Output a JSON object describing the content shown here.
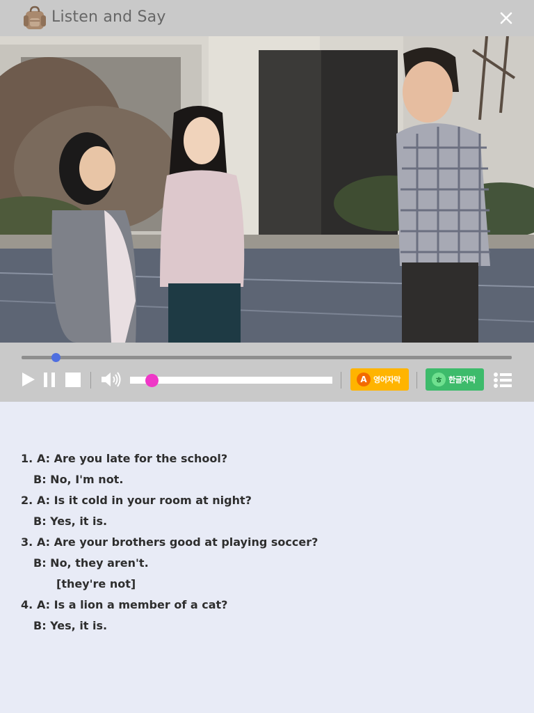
{
  "header": {
    "title": "Listen and Say",
    "close_icon": "close-icon",
    "logo_icon": "backpack-icon"
  },
  "video": {
    "scene": "video-frame"
  },
  "player": {
    "progress": 0.07,
    "volume": 0.11,
    "english_subtitle_badge": "A",
    "english_subtitle_label": "영어자막",
    "korean_subtitle_badge": "ㅎ",
    "korean_subtitle_label": "한글자막",
    "colors": {
      "seek_knob": "#4f6fe0",
      "volume_knob": "#ef37c7",
      "english_button": "#ffb400",
      "korean_button": "#3dbb6b"
    }
  },
  "script": [
    {
      "num": "1.",
      "speaker": "A:",
      "text": "Are you late for the school?"
    },
    {
      "speaker": "B:",
      "text": "No, I'm not."
    },
    {
      "num": "2.",
      "speaker": "A:",
      "text": "Is it cold in your room at night?"
    },
    {
      "speaker": "B:",
      "text": "Yes, it is."
    },
    {
      "num": "3.",
      "speaker": "A:",
      "text": "Are your brothers good at playing soccer?"
    },
    {
      "speaker": "B:",
      "text": "No, they aren't."
    },
    {
      "text": "[they're not]"
    },
    {
      "num": "4.",
      "speaker": "A:",
      "text": "Is a lion a member of a cat?"
    },
    {
      "speaker": "B:",
      "text": "Yes, it is."
    }
  ]
}
